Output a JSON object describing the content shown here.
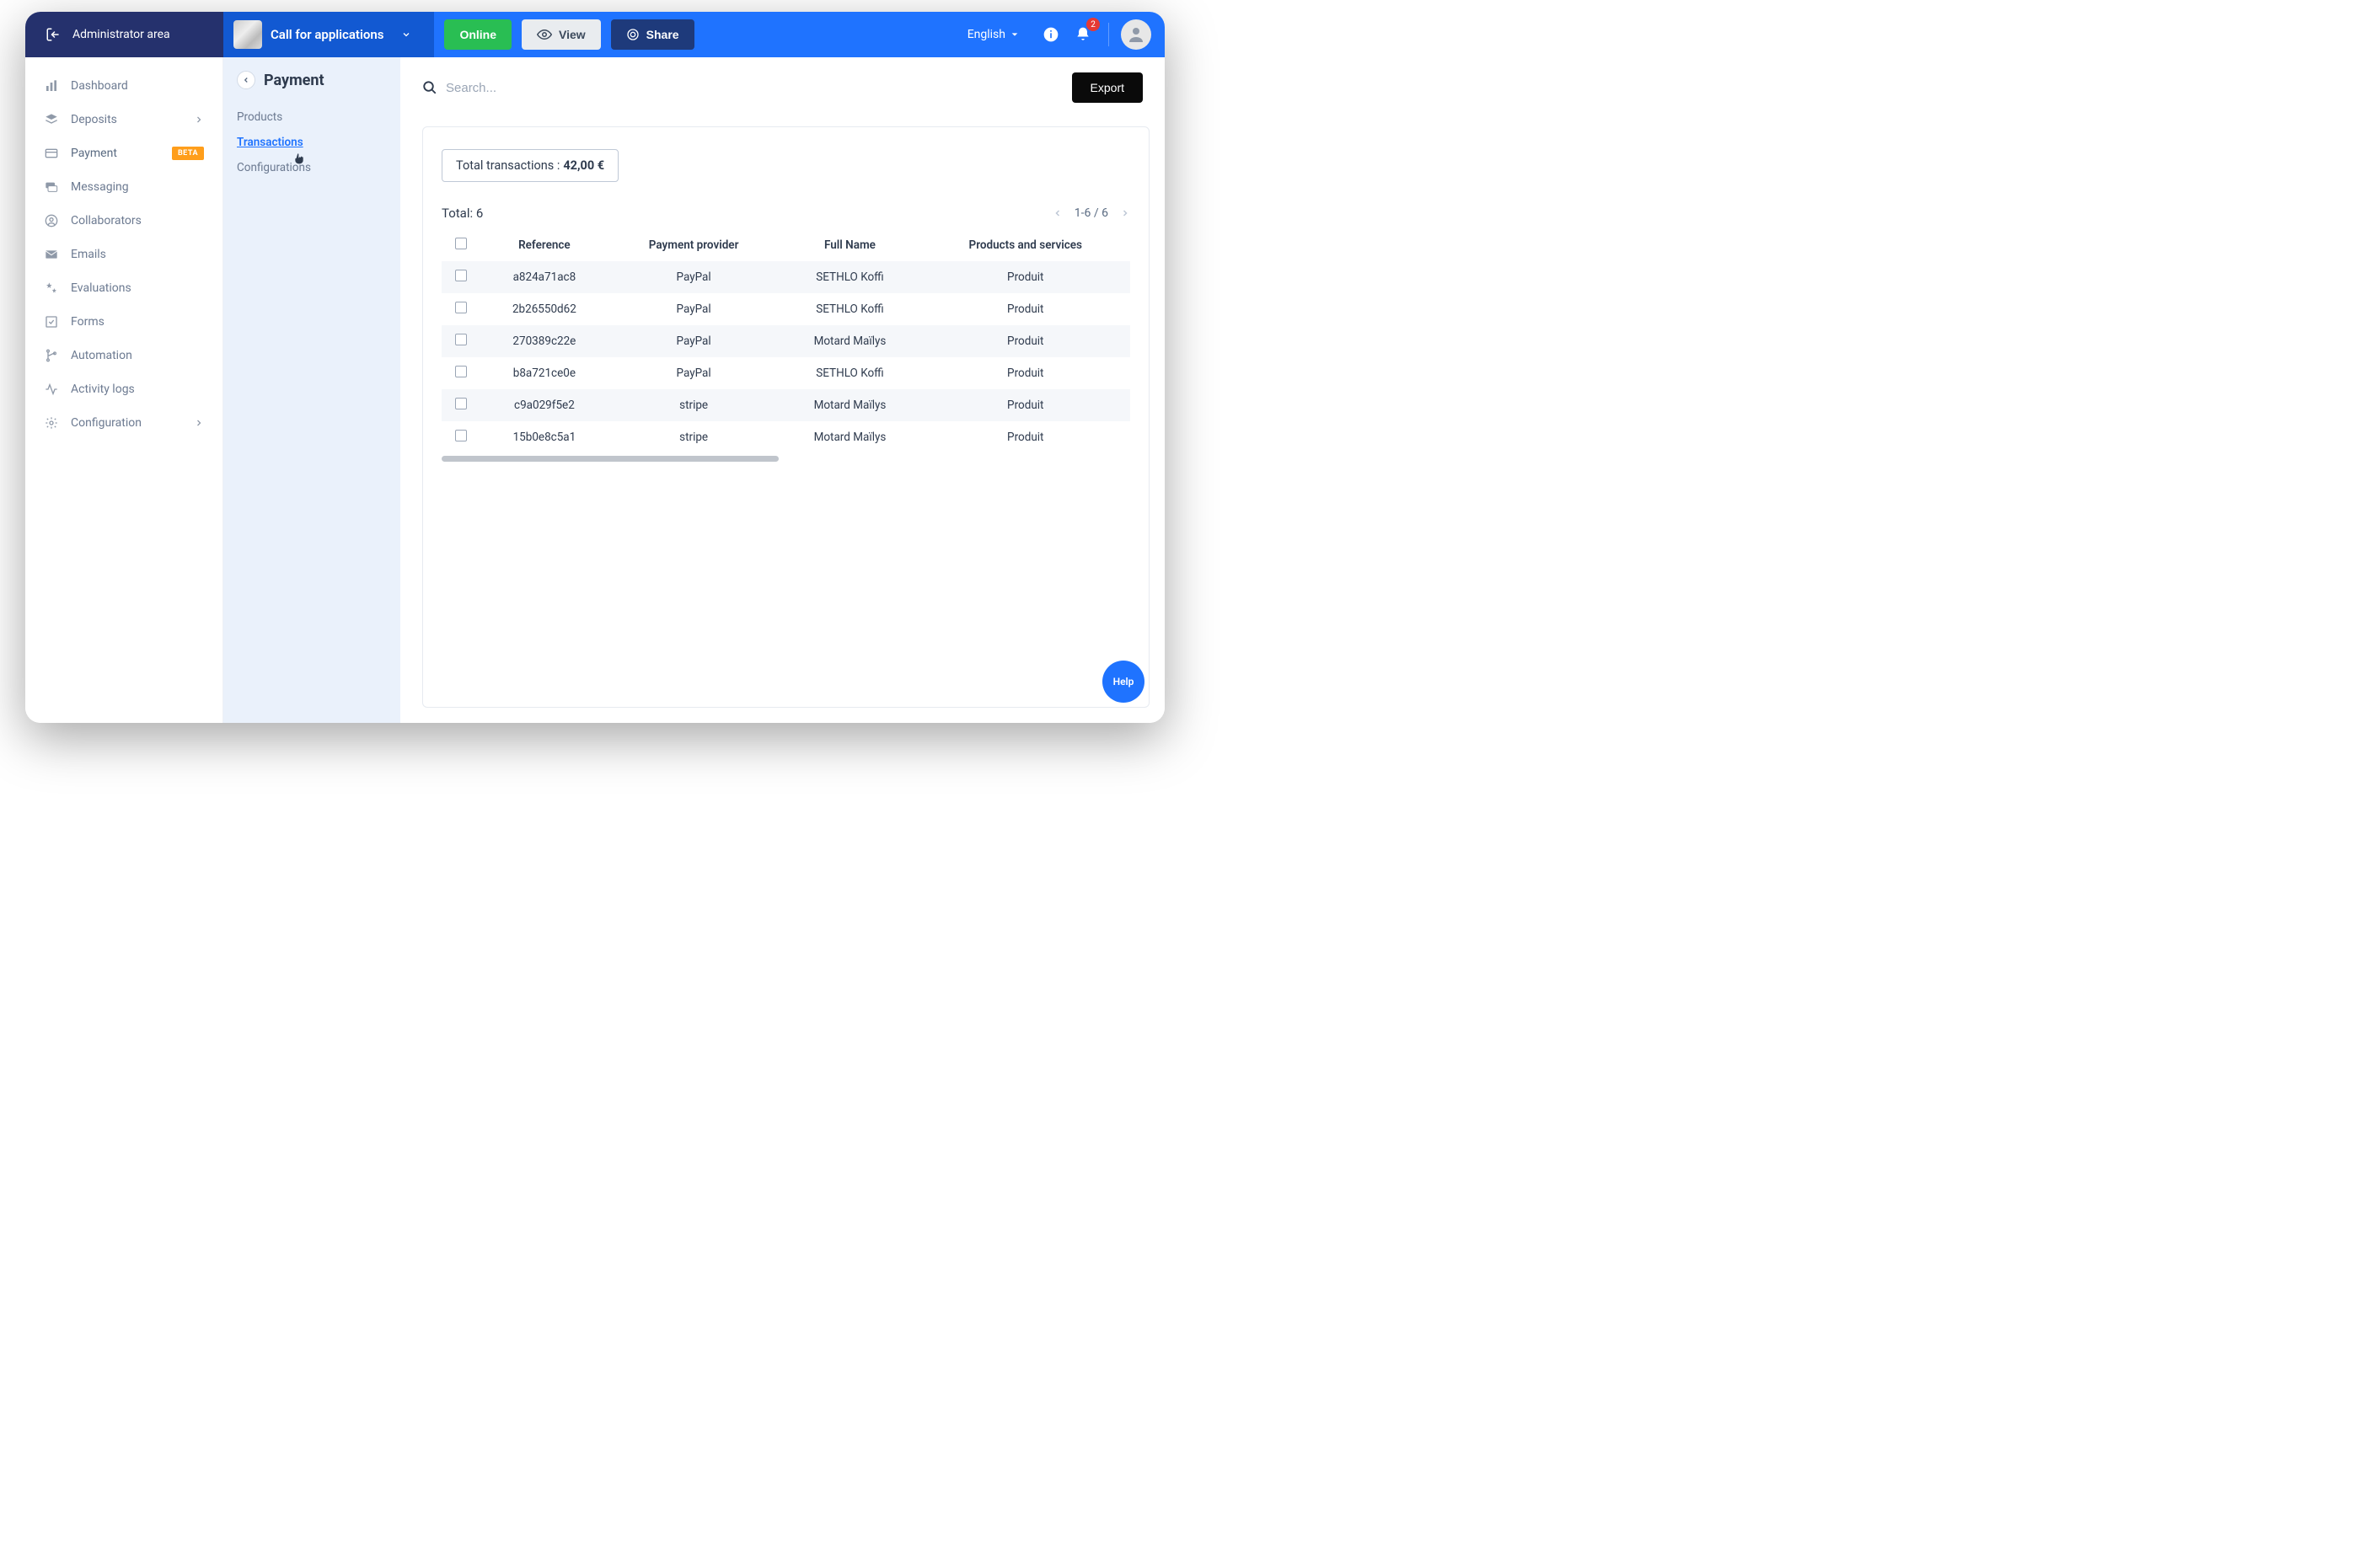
{
  "topbar": {
    "admin_label": "Administrator area",
    "project_label": "Call for applications",
    "online_label": "Online",
    "view_label": "View",
    "share_label": "Share",
    "language_label": "English",
    "notification_count": "2"
  },
  "sidebar": {
    "items": [
      {
        "label": "Dashboard",
        "icon": "bar-chart-icon"
      },
      {
        "label": "Deposits",
        "icon": "layers-icon",
        "has_chevron": true
      },
      {
        "label": "Payment",
        "icon": "card-icon",
        "badge": "BETA"
      },
      {
        "label": "Messaging",
        "icon": "chat-icon"
      },
      {
        "label": "Collaborators",
        "icon": "user-circle-icon"
      },
      {
        "label": "Emails",
        "icon": "mail-icon"
      },
      {
        "label": "Evaluations",
        "icon": "stars-icon"
      },
      {
        "label": "Forms",
        "icon": "check-square-icon"
      },
      {
        "label": "Automation",
        "icon": "branch-icon"
      },
      {
        "label": "Activity logs",
        "icon": "pulse-icon"
      },
      {
        "label": "Configuration",
        "icon": "gear-icon",
        "has_chevron": true
      }
    ]
  },
  "subpanel": {
    "title": "Payment",
    "items": [
      {
        "label": "Products"
      },
      {
        "label": "Transactions",
        "active": true
      },
      {
        "label": "Configurations"
      }
    ]
  },
  "search": {
    "placeholder": "Search..."
  },
  "actions": {
    "export_label": "Export"
  },
  "summary": {
    "total_transactions_label": "Total transactions : ",
    "total_transactions_value": "42,00 €",
    "total_count_label": "Total: 6"
  },
  "pager": {
    "range_label": "1-6 / 6"
  },
  "table": {
    "columns": [
      "Reference",
      "Payment provider",
      "Full Name",
      "Products and services"
    ],
    "rows": [
      {
        "reference": "a824a71ac8",
        "provider": "PayPal",
        "name": "SETHLO Koffi",
        "product": "Produit"
      },
      {
        "reference": "2b26550d62",
        "provider": "PayPal",
        "name": "SETHLO Koffi",
        "product": "Produit"
      },
      {
        "reference": "270389c22e",
        "provider": "PayPal",
        "name": "Motard Maïlys",
        "product": "Produit"
      },
      {
        "reference": "b8a721ce0e",
        "provider": "PayPal",
        "name": "SETHLO Koffi",
        "product": "Produit"
      },
      {
        "reference": "c9a029f5e2",
        "provider": "stripe",
        "name": "Motard Maïlys",
        "product": "Produit"
      },
      {
        "reference": "15b0e8c5a1",
        "provider": "stripe",
        "name": "Motard Maïlys",
        "product": "Produit"
      }
    ]
  },
  "help": {
    "label": "Help"
  }
}
